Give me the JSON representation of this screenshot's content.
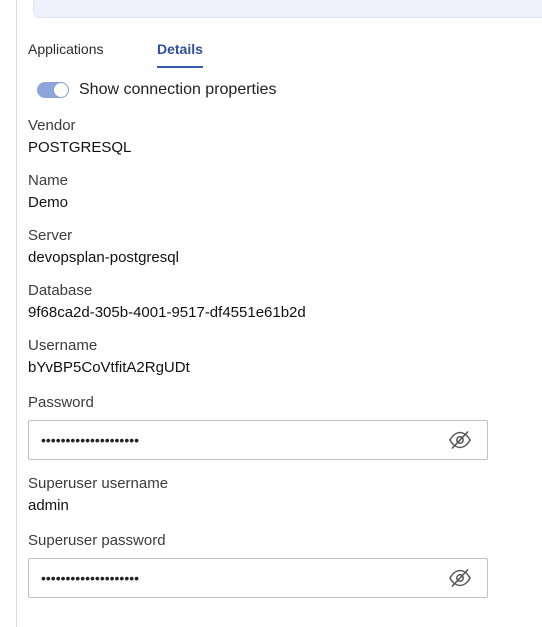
{
  "tabs": [
    {
      "label": "Applications",
      "active": false
    },
    {
      "label": "Details",
      "active": true
    }
  ],
  "toggle": {
    "label": "Show connection properties",
    "on": true
  },
  "fields": {
    "vendor": {
      "label": "Vendor",
      "value": "POSTGRESQL"
    },
    "name": {
      "label": "Name",
      "value": "Demo"
    },
    "server": {
      "label": "Server",
      "value": "devopsplan-postgresql"
    },
    "database": {
      "label": "Database",
      "value": "9f68ca2d-305b-4001-9517-df4551e61b2d"
    },
    "username": {
      "label": "Username",
      "value": "bYvBP5CoVtfitA2RgUDt"
    },
    "password": {
      "label": "Password",
      "value": "••••••••••••••••••••"
    },
    "superuser_username": {
      "label": "Superuser username",
      "value": "admin"
    },
    "superuser_password": {
      "label": "Superuser password",
      "value": "••••••••••••••••••••"
    }
  },
  "icons": {
    "reveal": "eye-slash-icon"
  },
  "colors": {
    "accent": "#3a5bb5",
    "toggle_on": "#8ea5dc",
    "banner": "#eef1fb"
  }
}
